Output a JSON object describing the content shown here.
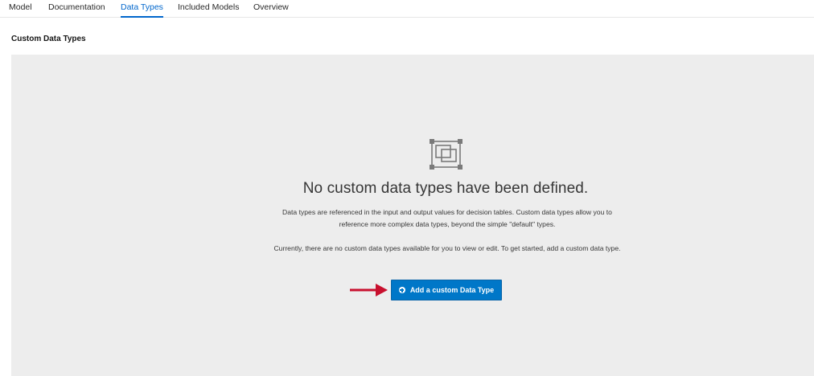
{
  "tabs": [
    {
      "label": "Model",
      "active": false
    },
    {
      "label": "Documentation",
      "active": false
    },
    {
      "label": "Data Types",
      "active": true
    },
    {
      "label": "Included Models",
      "active": false
    },
    {
      "label": "Overview",
      "active": false
    }
  ],
  "section_title": "Custom Data Types",
  "empty_state": {
    "icon": "empty-boxes-icon",
    "heading": "No custom data types have been defined.",
    "paragraph1": "Data types are referenced in the input and output values for decision tables. Custom data types allow you to reference more complex data types, beyond the simple \"default\" types.",
    "paragraph2": "Currently, there are no custom data types available for you to view or edit. To get started, add a custom data type.",
    "button_label": "Add a custom Data Type",
    "button_icon": "plus-circle-icon"
  },
  "annotation": {
    "icon": "red-arrow-icon",
    "color": "#c8102e"
  },
  "colors": {
    "accent": "#0066cc",
    "button": "#0077c8",
    "panel": "#ededed"
  }
}
